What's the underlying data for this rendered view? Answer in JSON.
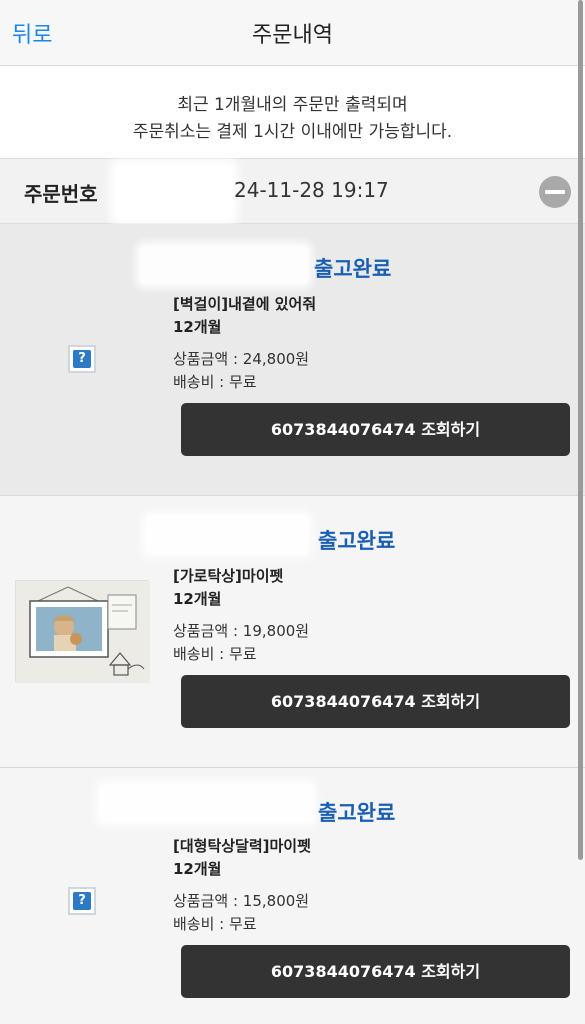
{
  "header": {
    "back_label": "뒤로",
    "title": "주문내역"
  },
  "notice": {
    "line1": "최근 1개월내의 주문만 출력되며",
    "line2": "주문취소는 결제 1시간 이내에만 가능합니다."
  },
  "order": {
    "number_label": "주문번호",
    "date": "24-11-28 19:17"
  },
  "items": [
    {
      "status": "출고완료",
      "name": "[벽걸이]내곁에 있어줘",
      "period": "12개월",
      "price": "상품금액 : 24,800원",
      "shipping": "배송비 : 무료",
      "track_button": "6073844076474 조회하기",
      "image": "missing-image-icon"
    },
    {
      "status": "출고완료",
      "name": "[가로탁상]마이펫",
      "period": "12개월",
      "price": "상품금액 : 19,800원",
      "shipping": "배송비 : 무료",
      "track_button": "6073844076474 조회하기",
      "image": "calendar-photo"
    },
    {
      "status": "출고완료",
      "name": "[대형탁상달력]마이펫",
      "period": "12개월",
      "price": "상품금액 : 15,800원",
      "shipping": "배송비 : 무료",
      "track_button": "6073844076474 조회하기",
      "image": "missing-image-icon"
    }
  ],
  "colors": {
    "accent": "#1a86e8",
    "status": "#1a5fb4",
    "button": "#333333"
  }
}
